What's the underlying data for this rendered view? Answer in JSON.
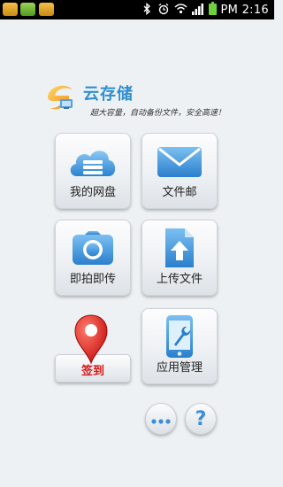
{
  "status_bar": {
    "time": "PM 2:16",
    "icons": [
      "bluetooth-icon",
      "alarm-icon",
      "wifi-icon",
      "signal-icon",
      "battery-icon"
    ]
  },
  "header": {
    "title": "云存储",
    "slogan": "超大容量，自动备份文件，安全高速！"
  },
  "tiles": [
    {
      "label": "我的网盘",
      "icon": "cloud-drive-icon"
    },
    {
      "label": "文件邮",
      "icon": "envelope-icon"
    },
    {
      "label": "即拍即传",
      "icon": "camera-icon"
    },
    {
      "label": "上传文件",
      "icon": "upload-file-icon"
    },
    {
      "label": "应用管理",
      "icon": "phone-wrench-icon"
    }
  ],
  "checkin": {
    "label": "签到",
    "icon": "map-pin-icon"
  },
  "round_buttons": {
    "more_icon": "more-dots-icon",
    "help_text": "?"
  },
  "colors": {
    "accent_blue": "#3a8fd8",
    "checkin_red": "#d41818",
    "background": "#eef1f4"
  }
}
